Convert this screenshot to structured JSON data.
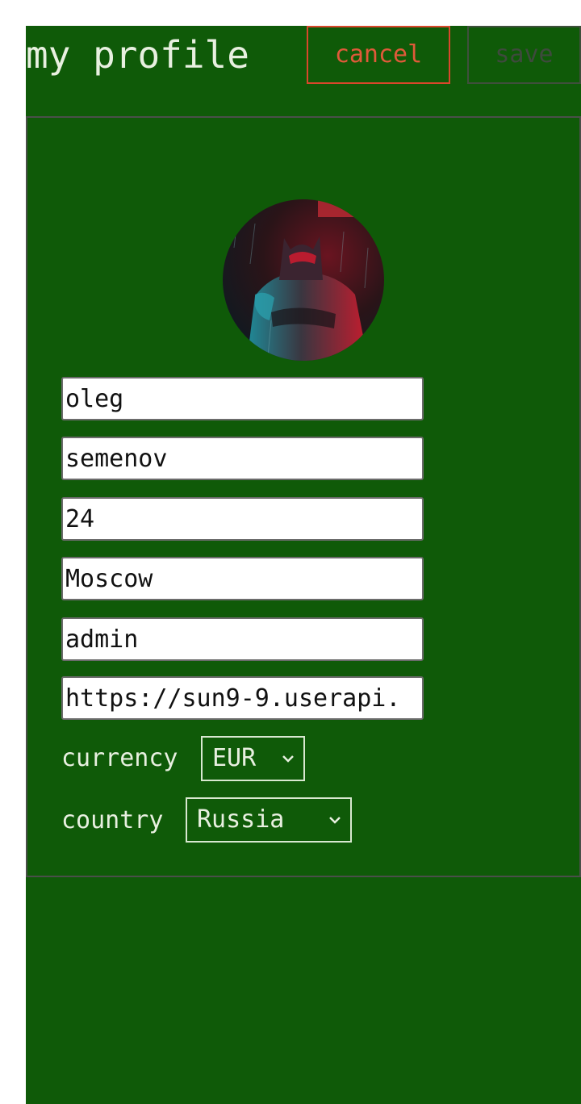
{
  "header": {
    "title": "my profile",
    "cancel_label": "cancel",
    "save_label": "save"
  },
  "avatar": {
    "icon": "avatar-image",
    "description_colors": [
      "#2a9aa8",
      "#c01a2a"
    ]
  },
  "form": {
    "first_name": "oleg",
    "last_name": "semenov",
    "age": "24",
    "city": "Moscow",
    "role": "admin",
    "avatar_url": "https://sun9-9.userapi."
  },
  "currency": {
    "label": "currency",
    "selected": "EUR"
  },
  "country": {
    "label": "country",
    "selected": "Russia"
  },
  "colors": {
    "background": "#0f5a08",
    "cancel": "#e05a3a",
    "save_disabled": "#3e4a3d",
    "text": "#e8f0e0"
  }
}
